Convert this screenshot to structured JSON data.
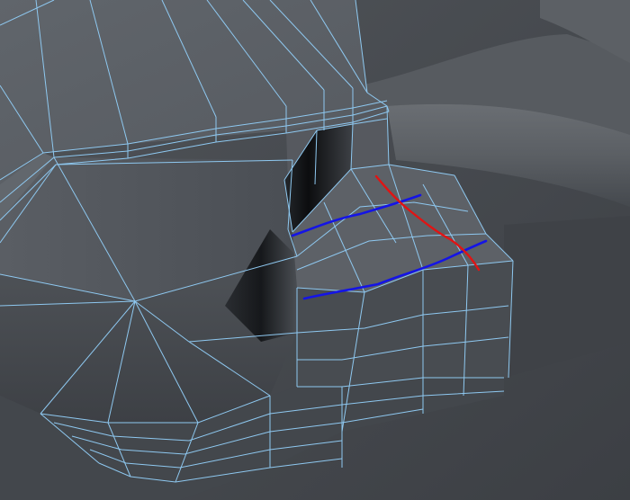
{
  "viewport": {
    "background_color": "#4a4e53",
    "wireframe_color": "#8ec8f0",
    "annotation_colors": {
      "blue": "#1414e6",
      "red": "#e01414"
    }
  },
  "annotations": {
    "blue_lines": 2,
    "red_lines": 1
  }
}
